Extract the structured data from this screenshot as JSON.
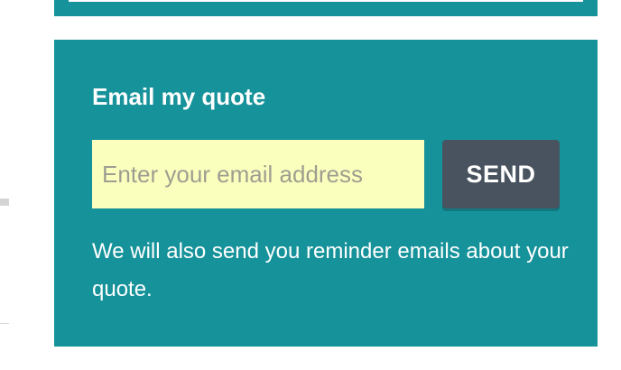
{
  "quote_form": {
    "title": "Email my quote",
    "email_placeholder": "Enter your email address",
    "email_value": "",
    "send_label": "SEND",
    "note": "We will also send you reminder emails about your quote."
  },
  "colors": {
    "panel_background": "#16929a",
    "input_background": "#fbffbd",
    "button_background": "#48535f",
    "text": "#ffffff"
  }
}
